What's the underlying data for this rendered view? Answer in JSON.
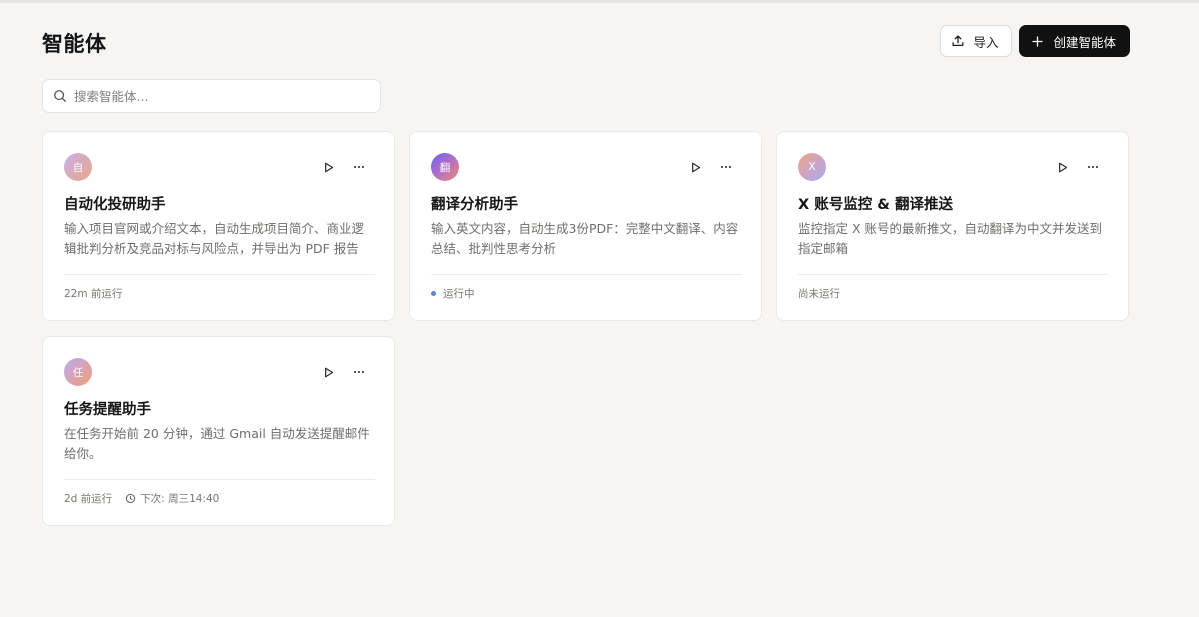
{
  "header": {
    "title": "智能体",
    "import_label": "导入",
    "create_label": "创建智能体"
  },
  "search": {
    "placeholder": "搜索智能体...",
    "value": ""
  },
  "cards": [
    {
      "avatar_text": "自",
      "title": "自动化投研助手",
      "description": "输入项目官网或介绍文本，自动生成项目简介、商业逻辑批判分析及竞品对标与风险点，并导出为 PDF 报告",
      "last_run": "22m 前运行"
    },
    {
      "avatar_text": "翻",
      "title": "翻译分析助手",
      "description": "输入英文内容，自动生成3份PDF：完整中文翻译、内容总结、批判性思考分析",
      "status": "运行中",
      "status_color": "#5d87c7"
    },
    {
      "avatar_text": "X",
      "title": "X 账号监控 & 翻译推送",
      "description": "监控指定 X 账号的最新推文，自动翻译为中文并发送到指定邮箱",
      "last_run": "尚未运行"
    },
    {
      "avatar_text": "任",
      "title": "任务提醒助手",
      "description": "在任务开始前 20 分钟，通过 Gmail 自动发送提醒邮件给你。",
      "last_run": "2d 前运行",
      "next_run": "下次: 周三14:40"
    }
  ],
  "icons": {
    "import": "upload-icon",
    "create": "plus-icon",
    "search": "search-icon",
    "run": "play-icon",
    "more": "more-horizontal-icon",
    "next": "clock-icon"
  },
  "colors": {
    "primary_button": "#111111",
    "background": "#f6f5f3",
    "running_dot": "#5d87c7"
  }
}
